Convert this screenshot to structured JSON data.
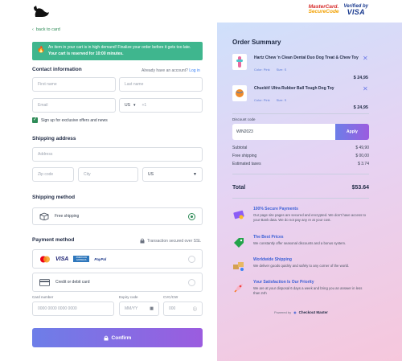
{
  "header": {
    "badge_mc_1": "MasterCard.",
    "badge_mc_2": "SecureCode",
    "badge_vbv_1": "Verified by",
    "badge_vbv_2": "VISA"
  },
  "nav": {
    "back_label": "back to card"
  },
  "alert": {
    "line1": "An item in your cart is in high demand! Finalize your order before it gets too late.",
    "line2": "Your cart is reserved for 10:00 minutes."
  },
  "contact": {
    "title": "Contact information",
    "account_prompt": "Already have an account?",
    "login_label": "Log in",
    "first_name_placeholder": "First name",
    "last_name_placeholder": "Last name",
    "email_placeholder": "Email",
    "country_code": "US",
    "phone_placeholder": "+1",
    "newsletter_label": "Sign up for exclusive offers and news"
  },
  "shipping_address": {
    "title": "Shipping address",
    "address_placeholder": "Address",
    "zip_placeholder": "Zip code",
    "city_placeholder": "City",
    "country": "US"
  },
  "shipping_method": {
    "title": "Shipping method",
    "option_label": "Free shipping"
  },
  "payment": {
    "title": "Payment method",
    "secure_note": "Transaction secured over SSL",
    "card_label": "Credit or debit card",
    "card_number_label": "Card number",
    "card_number_placeholder": "0000 0000 0000 0000",
    "expiry_label": "Expiry code",
    "expiry_placeholder": "MM/YY",
    "cvc_label": "CVC/CW",
    "cvc_placeholder": "000",
    "logo_visa": "VISA",
    "logo_amex": "AMERICAN EXPRESS",
    "logo_paypal": "PayPal"
  },
  "confirm_label": "Confirm",
  "summary": {
    "title": "Order Summary",
    "items": [
      {
        "name": "Hartz Chew 'n Clean Dental Duo Dog Treat & Chew Toy",
        "color": "Color: Pink",
        "size": "Size: S",
        "price": "$ 24,95"
      },
      {
        "name": "Chuckit! Ultra Rubber Ball Tough Dog Toy",
        "color": "Color: Pink",
        "size": "Size: S",
        "price": "$ 24,95"
      }
    ],
    "discount_label": "Discount code",
    "discount_value": "WIN2023",
    "apply_label": "Apply",
    "subtotal_label": "Subtotal",
    "subtotal_value": "$ 49,90",
    "free_shipping_label": "Free shipping",
    "free_shipping_value": "$ 00,00",
    "taxes_label": "Estimated taxes",
    "taxes_value": "$ 3.74",
    "total_label": "Total",
    "total_value": "$53.64"
  },
  "features": [
    {
      "title": "100% Secure Payments",
      "desc": "Our page site pages are secured and encrypted. We don't have access to your Bank data. We do not pay any re at your cost."
    },
    {
      "title": "The Best Prices",
      "desc": "We constantly offer seasonal discounts and a bonus system."
    },
    {
      "title": "Worldwide Shipping",
      "desc": "We deliver goods quickly and safely to any corner of the world."
    },
    {
      "title": "Your Satisfaction Is Our Priority",
      "desc": "We are at your disposal 6 days a week and bring you an answer in less than 24h"
    }
  ],
  "powered": {
    "prefix": "Powered by",
    "brand": "Checkout Master"
  },
  "colors": {
    "accent_green": "#2e8b57",
    "alert_bg": "#3fb68e",
    "button_start": "#6d7ee8",
    "button_end": "#9b5cdf"
  }
}
